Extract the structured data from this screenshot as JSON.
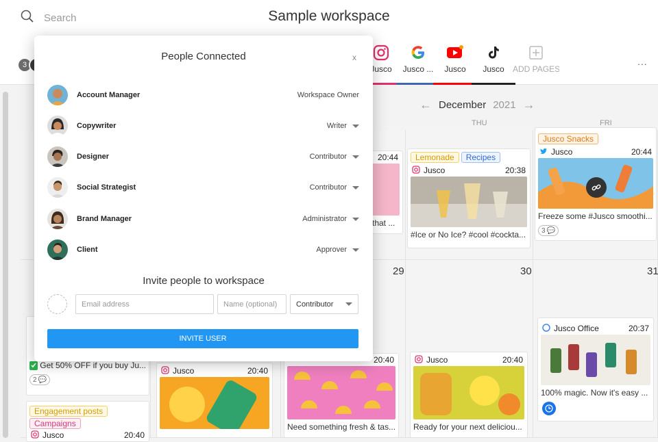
{
  "search": {
    "placeholder": "Search",
    "icon": "search-icon"
  },
  "workspace": {
    "title": "Sample workspace"
  },
  "members": {
    "count": "3"
  },
  "channels": [
    {
      "label": "Jusco",
      "icon": "instagram-icon",
      "color": "#e1306c"
    },
    {
      "label": "Jusco ...",
      "icon": "google-icon",
      "color": "#4267b2"
    },
    {
      "label": "Jusco",
      "icon": "youtube-icon",
      "color": "#ff0000"
    },
    {
      "label": "Jusco",
      "icon": "tiktok-icon",
      "color": "#222222"
    },
    {
      "label": "ADD PAGES",
      "icon": "plus-icon",
      "color": "#bbbbbb"
    }
  ],
  "more_label": "...",
  "calendar": {
    "month": "December",
    "year": "2021",
    "weekdays": [
      "THU",
      "FRI"
    ],
    "day_numbers": [
      "29",
      "30",
      "31"
    ]
  },
  "posts": {
    "p_wed_top": {
      "time": "20:44",
      "caption": "that ..."
    },
    "p_thu_top": {
      "tags": [
        "Lemonade",
        "Recipes"
      ],
      "account": "Jusco",
      "time": "20:38",
      "caption": "#Ice or No Ice? #cool #cockta..."
    },
    "p_fri_top": {
      "tags": [
        "Jusco Snacks"
      ],
      "account": "Jusco",
      "time": "20:44",
      "caption": "Freeze some #Jusco smoothi...",
      "comments": "3"
    },
    "p_fri_mid": {
      "account": "Jusco Office",
      "time": "20:37",
      "caption": "100% magic. Now it's easy ..."
    },
    "p_mon_mid": {
      "caption": "Get 50% OFF if you buy Ju...",
      "comments": "2"
    },
    "p_mon_bot": {
      "tags": [
        "Engagement posts",
        "Campaigns"
      ],
      "account": "Jusco",
      "time": "20:40"
    },
    "p_tue_mid": {
      "account": "Jusco",
      "time": "20:40"
    },
    "p_wed_mid": {
      "time": "20:40",
      "caption": "Need something fresh & tas..."
    },
    "p_thu_mid": {
      "account": "Jusco",
      "time": "20:40",
      "caption": "Ready for your next deliciou..."
    }
  },
  "modal": {
    "title": "People Connected",
    "close": "x",
    "people": [
      {
        "name": "Account Manager",
        "role": "Workspace Owner",
        "has_dropdown": false
      },
      {
        "name": "Copywriter",
        "role": "Writer",
        "has_dropdown": true
      },
      {
        "name": "Designer",
        "role": "Contributor",
        "has_dropdown": true
      },
      {
        "name": "Social Strategist",
        "role": "Contributor",
        "has_dropdown": true
      },
      {
        "name": "Brand Manager",
        "role": "Administrator",
        "has_dropdown": true
      },
      {
        "name": "Client",
        "role": "Approver",
        "has_dropdown": true
      }
    ],
    "invite": {
      "title": "Invite people to workspace",
      "email_placeholder": "Email address",
      "name_placeholder": "Name (optional)",
      "role_value": "Contributor",
      "button": "INVITE USER"
    }
  }
}
